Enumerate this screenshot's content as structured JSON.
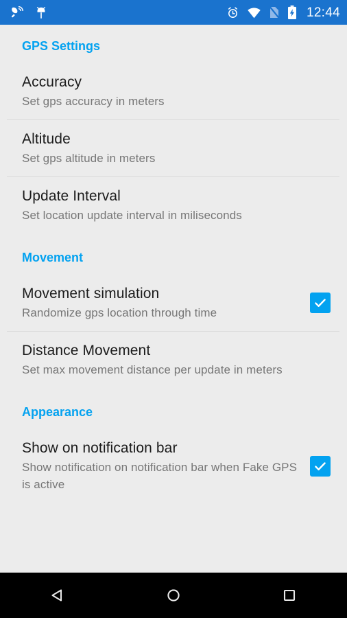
{
  "status_bar": {
    "left_icons": [
      {
        "name": "satellite-dish-icon",
        "label": "satellite-dish"
      },
      {
        "name": "fake-gps-app-icon",
        "label": "fake-gps-marker"
      }
    ],
    "right_icons": [
      {
        "name": "alarm-clock-icon",
        "label": "alarm"
      },
      {
        "name": "wifi-icon",
        "label": "wifi-full"
      },
      {
        "name": "no-sim-icon",
        "label": "signal-off"
      },
      {
        "name": "battery-charging-icon",
        "label": "battery-charging"
      }
    ],
    "time": "12:44",
    "background_color": "#1a73ce",
    "foreground_color": "#ffffff"
  },
  "theme": {
    "accent_color": "#03a2f0",
    "background_color": "#ececec",
    "title_color": "#1c1c1c",
    "summary_color": "#767676",
    "divider_color": "#dadada"
  },
  "sections": [
    {
      "header": "GPS Settings",
      "items": [
        {
          "title": "Accuracy",
          "summary": "Set gps accuracy in meters",
          "has_checkbox": false,
          "checked": false
        },
        {
          "title": "Altitude",
          "summary": "Set gps altitude in meters",
          "has_checkbox": false,
          "checked": false
        },
        {
          "title": "Update Interval",
          "summary": "Set location update interval in miliseconds",
          "has_checkbox": false,
          "checked": false
        }
      ]
    },
    {
      "header": "Movement",
      "items": [
        {
          "title": "Movement simulation",
          "summary": "Randomize gps location through time",
          "has_checkbox": true,
          "checked": true
        },
        {
          "title": "Distance Movement",
          "summary": "Set max movement distance per update in meters",
          "has_checkbox": false,
          "checked": false
        }
      ]
    },
    {
      "header": "Appearance",
      "items": [
        {
          "title": "Show on notification bar",
          "summary": "Show notification on notification bar when Fake GPS is active",
          "has_checkbox": true,
          "checked": true
        }
      ]
    }
  ],
  "nav_bar": {
    "buttons": [
      {
        "name": "back-button",
        "icon": "back-triangle-icon"
      },
      {
        "name": "home-button",
        "icon": "home-circle-icon"
      },
      {
        "name": "recents-button",
        "icon": "recents-square-icon"
      }
    ],
    "background_color": "#000000"
  }
}
